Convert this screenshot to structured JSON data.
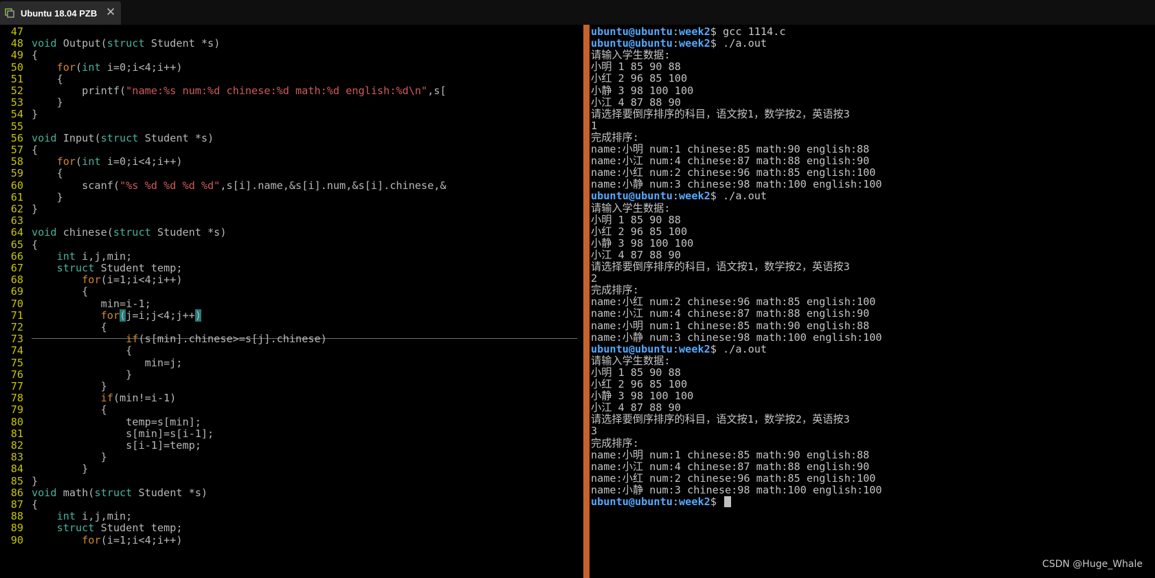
{
  "window": {
    "tab_title": "Ubuntu 18.04 PZB",
    "close_glyph": "✕",
    "tab_icon": "vm-icon"
  },
  "editor": {
    "lines": [
      {
        "n": "47",
        "t": ""
      },
      {
        "n": "48",
        "t": "void Output(struct Student *s)"
      },
      {
        "n": "49",
        "t": "{"
      },
      {
        "n": "50",
        "t": "    for(int i=0;i<4;i++)"
      },
      {
        "n": "51",
        "t": "    {"
      },
      {
        "n": "52",
        "t": "        printf(\"name:%s num:%d chinese:%d math:%d english:%d\\n\",s["
      },
      {
        "n": "53",
        "t": "    }"
      },
      {
        "n": "54",
        "t": "}"
      },
      {
        "n": "55",
        "t": ""
      },
      {
        "n": "56",
        "t": "void Input(struct Student *s)"
      },
      {
        "n": "57",
        "t": "{"
      },
      {
        "n": "58",
        "t": "    for(int i=0;i<4;i++)"
      },
      {
        "n": "59",
        "t": "    {"
      },
      {
        "n": "60",
        "t": "        scanf(\"%s %d %d %d %d\",s[i].name,&s[i].num,&s[i].chinese,&"
      },
      {
        "n": "61",
        "t": "    }"
      },
      {
        "n": "62",
        "t": "}"
      },
      {
        "n": "63",
        "t": ""
      },
      {
        "n": "64",
        "t": "void chinese(struct Student *s)"
      },
      {
        "n": "65",
        "t": "{"
      },
      {
        "n": "66",
        "t": "    int i,j,min;"
      },
      {
        "n": "67",
        "t": "    struct Student temp;"
      },
      {
        "n": "68",
        "t": "        for(i=1;i<4;i++)"
      },
      {
        "n": "69",
        "t": "        {"
      },
      {
        "n": "70",
        "t": "           min=i-1;"
      },
      {
        "n": "71",
        "t": "           for(j=i;j<4;j++)"
      },
      {
        "n": "72",
        "t": "           {"
      },
      {
        "n": "73",
        "t": "               if(s[min].chinese>=s[j].chinese)"
      },
      {
        "n": "74",
        "t": "               {"
      },
      {
        "n": "75",
        "t": "                  min=j;"
      },
      {
        "n": "76",
        "t": "               }"
      },
      {
        "n": "77",
        "t": "           }"
      },
      {
        "n": "78",
        "t": "           if(min!=i-1)"
      },
      {
        "n": "79",
        "t": "           {"
      },
      {
        "n": "80",
        "t": "               temp=s[min];"
      },
      {
        "n": "81",
        "t": "               s[min]=s[i-1];"
      },
      {
        "n": "82",
        "t": "               s[i-1]=temp;"
      },
      {
        "n": "83",
        "t": "           }"
      },
      {
        "n": "84",
        "t": "        }"
      },
      {
        "n": "85",
        "t": "}"
      },
      {
        "n": "86",
        "t": "void math(struct Student *s)"
      },
      {
        "n": "87",
        "t": "{"
      },
      {
        "n": "88",
        "t": "    int i,j,min;"
      },
      {
        "n": "89",
        "t": "    struct Student temp;"
      },
      {
        "n": "90",
        "t": "        for(i=1;i<4;i++)"
      }
    ],
    "colors": {
      "keyword": "#d08833",
      "type": "#45b39d",
      "string": "#d05a5a",
      "linenum": "#c8c800",
      "text": "#b8b8b8",
      "match_highlight": "#237a7a"
    }
  },
  "terminal": {
    "prompt_user": "ubuntu@ubuntu",
    "prompt_dir": "week2",
    "lines": [
      {
        "p": true,
        "t": "gcc 1114.c"
      },
      {
        "p": true,
        "t": "./a.out"
      },
      {
        "t": "请输入学生数据:"
      },
      {
        "t": "小明 1 85 90 88"
      },
      {
        "t": "小红 2 96 85 100"
      },
      {
        "t": "小静 3 98 100 100"
      },
      {
        "t": "小江 4 87 88 90"
      },
      {
        "t": "请选择要倒序排序的科目，语文按1，数学按2，英语按3"
      },
      {
        "t": "1"
      },
      {
        "t": "完成排序:"
      },
      {
        "t": "name:小明 num:1 chinese:85 math:90 english:88"
      },
      {
        "t": "name:小江 num:4 chinese:87 math:88 english:90"
      },
      {
        "t": "name:小红 num:2 chinese:96 math:85 english:100"
      },
      {
        "t": "name:小静 num:3 chinese:98 math:100 english:100"
      },
      {
        "p": true,
        "t": "./a.out"
      },
      {
        "t": "请输入学生数据:"
      },
      {
        "t": "小明 1 85 90 88"
      },
      {
        "t": "小红 2 96 85 100"
      },
      {
        "t": "小静 3 98 100 100"
      },
      {
        "t": "小江 4 87 88 90"
      },
      {
        "t": "请选择要倒序排序的科目，语文按1，数学按2，英语按3"
      },
      {
        "t": "2"
      },
      {
        "t": "完成排序:"
      },
      {
        "t": "name:小红 num:2 chinese:96 math:85 english:100"
      },
      {
        "t": "name:小江 num:4 chinese:87 math:88 english:90"
      },
      {
        "t": "name:小明 num:1 chinese:85 math:90 english:88"
      },
      {
        "t": "name:小静 num:3 chinese:98 math:100 english:100"
      },
      {
        "p": true,
        "t": "./a.out"
      },
      {
        "t": "请输入学生数据:"
      },
      {
        "t": "小明 1 85 90 88"
      },
      {
        "t": "小红 2 96 85 100"
      },
      {
        "t": "小静 3 98 100 100"
      },
      {
        "t": "小江 4 87 88 90"
      },
      {
        "t": "请选择要倒序排序的科目，语文按1，数学按2，英语按3"
      },
      {
        "t": "3"
      },
      {
        "t": "完成排序:"
      },
      {
        "t": "name:小明 num:1 chinese:85 math:90 english:88"
      },
      {
        "t": "name:小江 num:4 chinese:87 math:88 english:90"
      },
      {
        "t": "name:小红 num:2 chinese:96 math:85 english:100"
      },
      {
        "t": "name:小静 num:3 chinese:98 math:100 english:100"
      },
      {
        "p": true,
        "t": "",
        "cursor": true
      }
    ],
    "colors": {
      "prompt_user": "#55aaff",
      "separator": "#c8622c"
    }
  },
  "watermark": "CSDN @Huge_Whale"
}
